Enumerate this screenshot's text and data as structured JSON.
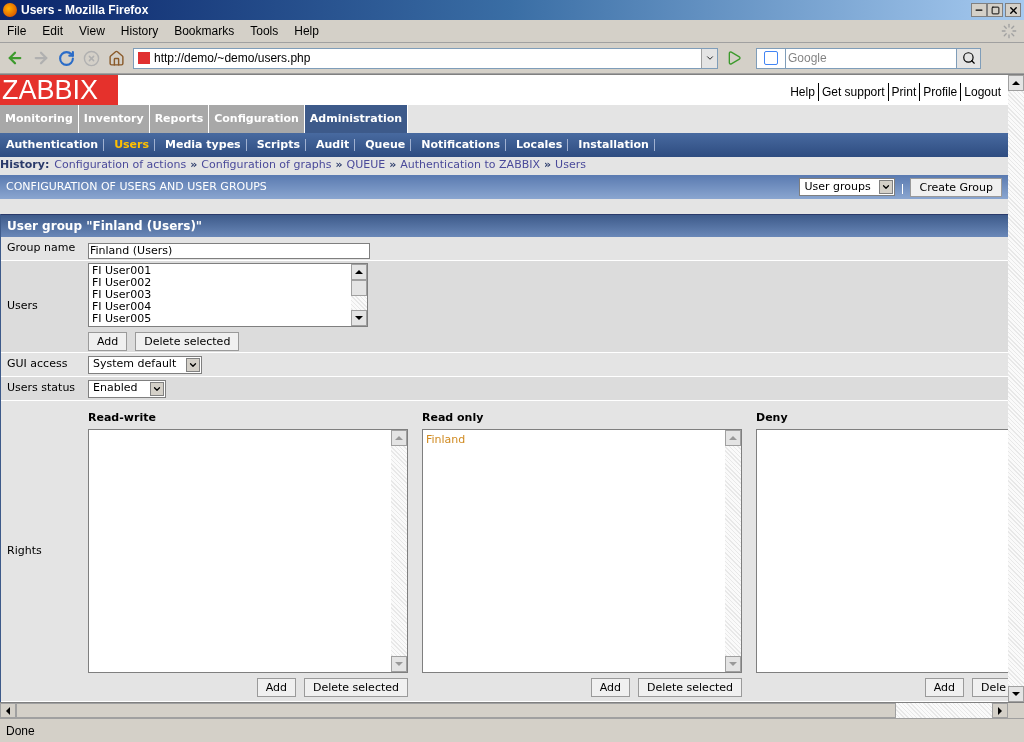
{
  "window": {
    "title": "Users - Mozilla Firefox"
  },
  "menu_bar": [
    "File",
    "Edit",
    "View",
    "History",
    "Bookmarks",
    "Tools",
    "Help"
  ],
  "address_bar": {
    "value": "http://demo/~demo/users.php"
  },
  "search_field": {
    "placeholder": "Google"
  },
  "logo": "ZABBIX",
  "top_links": [
    "Help",
    "Get support",
    "Print",
    "Profile",
    "Logout"
  ],
  "main_tabs": [
    {
      "label": "Monitoring",
      "selected": false
    },
    {
      "label": "Inventory",
      "selected": false
    },
    {
      "label": "Reports",
      "selected": false
    },
    {
      "label": "Configuration",
      "selected": false
    },
    {
      "label": "Administration",
      "selected": true
    }
  ],
  "sub_menu": [
    {
      "label": "Authentication",
      "selected": false
    },
    {
      "label": "Users",
      "selected": true
    },
    {
      "label": "Media types",
      "selected": false
    },
    {
      "label": "Scripts",
      "selected": false
    },
    {
      "label": "Audit",
      "selected": false
    },
    {
      "label": "Queue",
      "selected": false
    },
    {
      "label": "Notifications",
      "selected": false
    },
    {
      "label": "Locales",
      "selected": false
    },
    {
      "label": "Installation",
      "selected": false
    }
  ],
  "history": {
    "label": "History:",
    "separator": "»",
    "items": [
      "Configuration of actions",
      "Configuration of graphs",
      "QUEUE",
      "Authentication to ZABBIX",
      "Users"
    ]
  },
  "section_bar": {
    "title": "CONFIGURATION OF USERS AND USER GROUPS",
    "select": "User groups",
    "button": "Create Group"
  },
  "form": {
    "title": "User group \"Finland (Users)\"",
    "group_name": {
      "label": "Group name",
      "value": "Finland (Users)"
    },
    "users": {
      "label": "Users",
      "items": [
        "FI User001",
        "FI User002",
        "FI User003",
        "FI User004",
        "FI User005"
      ],
      "buttons": [
        "Add",
        "Delete selected"
      ]
    },
    "gui_access": {
      "label": "GUI access",
      "value": "System default"
    },
    "users_status": {
      "label": "Users status",
      "value": "Enabled"
    },
    "rights": {
      "label": "Rights",
      "columns": [
        {
          "title": "Read-write",
          "buttons": [
            "Add",
            "Delete selected"
          ]
        },
        {
          "title": "Read only",
          "items": [
            "Finland"
          ],
          "buttons": [
            "Add",
            "Delete selected"
          ]
        },
        {
          "title": "Deny",
          "buttons": [
            "Add",
            "Dele"
          ]
        }
      ]
    }
  },
  "status_bar": "Done"
}
